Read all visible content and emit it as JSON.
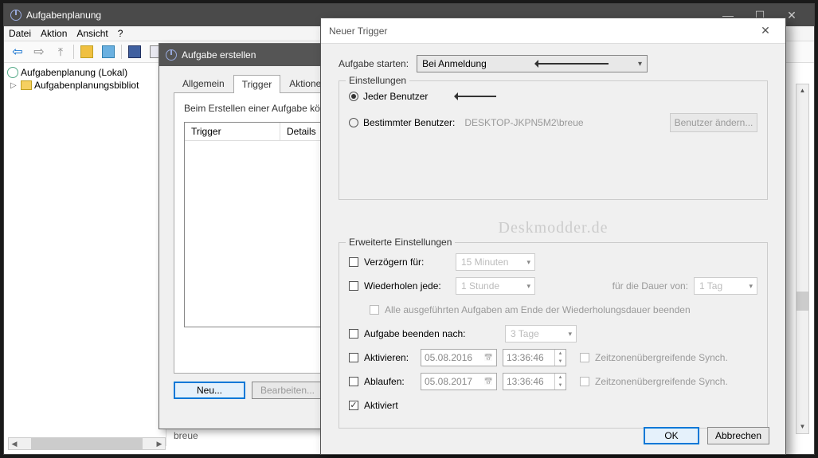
{
  "main": {
    "title": "Aufgabenplanung",
    "menu": [
      "Datei",
      "Aktion",
      "Ansicht",
      "?"
    ],
    "tree": {
      "root": "Aufgabenplanung (Lokal)",
      "child": "Aufgabenplanungsbibliot"
    }
  },
  "create_dialog": {
    "title": "Aufgabe erstellen",
    "tabs": [
      "Allgemein",
      "Trigger",
      "Aktionen"
    ],
    "hint": "Beim Erstellen einer Aufgabe kö",
    "list_headers": [
      "Trigger",
      "Details"
    ],
    "btn_new": "Neu...",
    "btn_edit": "Bearbeiten..."
  },
  "trigger_dialog": {
    "title": "Neuer Trigger",
    "start_label": "Aufgabe starten:",
    "start_value": "Bei Anmeldung",
    "settings_legend": "Einstellungen",
    "radio_any": "Jeder Benutzer",
    "radio_specific": "Bestimmter Benutzer:",
    "specific_user": "DESKTOP-JKPN5M2\\breue",
    "change_user_btn": "Benutzer ändern...",
    "watermark": "Deskmodder.de",
    "adv_legend": "Erweiterte Einstellungen",
    "delay_label": "Verzögern für:",
    "delay_value": "15 Minuten",
    "repeat_label": "Wiederholen jede:",
    "repeat_value": "1 Stunde",
    "duration_label": "für die Dauer von:",
    "duration_value": "1 Tag",
    "stop_all_label": "Alle ausgeführten Aufgaben am Ende der Wiederholungsdauer beenden",
    "stop_after_label": "Aufgabe beenden nach:",
    "stop_after_value": "3 Tage",
    "activate_label": "Aktivieren:",
    "activate_date": "05.08.2016",
    "activate_time": "13:36:46",
    "expire_label": "Ablaufen:",
    "expire_date": "05.08.2017",
    "expire_time": "13:36:46",
    "tz_sync": "Zeitzonenübergreifende Synch.",
    "enabled_label": "Aktiviert",
    "ok": "OK",
    "cancel": "Abbrechen"
  },
  "truncated_bottom": "breue"
}
